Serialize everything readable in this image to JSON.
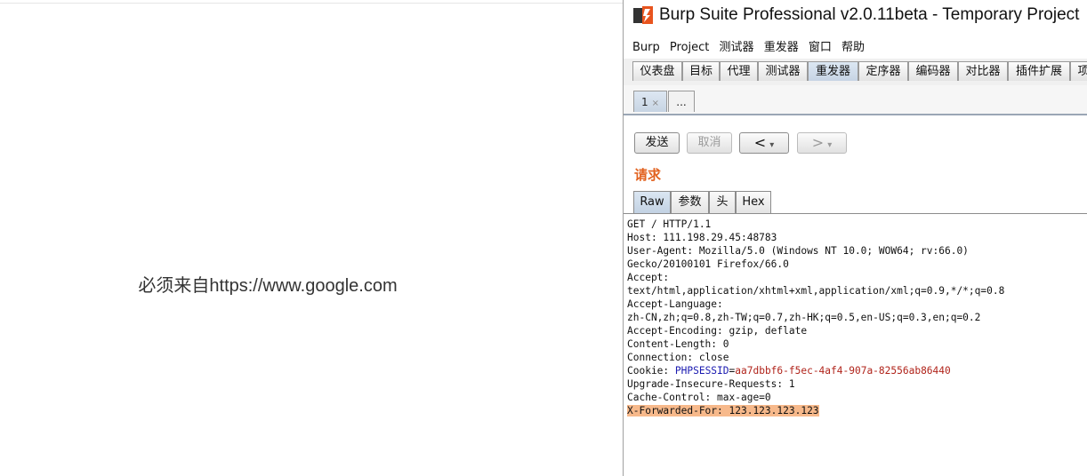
{
  "browser": {
    "message": "必须来自https://www.google.com"
  },
  "burp": {
    "title": "Burp Suite Professional v2.0.11beta - Temporary Project",
    "menu": [
      "Burp",
      "Project",
      "测试器",
      "重发器",
      "窗口",
      "帮助"
    ],
    "tabs": [
      "仪表盘",
      "目标",
      "代理",
      "测试器",
      "重发器",
      "定序器",
      "编码器",
      "对比器",
      "插件扩展",
      "项"
    ],
    "active_tab": "重发器",
    "subtabs": {
      "first": "1",
      "close": "×",
      "more": "..."
    },
    "buttons": {
      "send": "发送",
      "cancel": "取消",
      "back": "<",
      "forward": ">",
      "dropdown": "▾"
    },
    "request_label": "请求",
    "request_tabs": [
      "Raw",
      "参数",
      "头",
      "Hex"
    ],
    "request_lines": {
      "l1": "GET / HTTP/1.1",
      "l2": "Host: 111.198.29.45:48783",
      "l3": "User-Agent: Mozilla/5.0 (Windows NT 10.0; WOW64; rv:66.0)",
      "l4": "Gecko/20100101 Firefox/66.0",
      "l5": "Accept:",
      "l6": "text/html,application/xhtml+xml,application/xml;q=0.9,*/*;q=0.8",
      "l7": "Accept-Language:",
      "l8": "zh-CN,zh;q=0.8,zh-TW;q=0.7,zh-HK;q=0.5,en-US;q=0.3,en;q=0.2",
      "l9": "Accept-Encoding: gzip, deflate",
      "l10": "Content-Length: 0",
      "l11": "Connection: close",
      "cookie_prefix": "Cookie: ",
      "cookie_name": "PHPSESSID",
      "cookie_eq": "=",
      "cookie_value": "aa7dbbf6-f5ec-4af4-907a-82556ab86440",
      "l13": "Upgrade-Insecure-Requests: 1",
      "l14": "Cache-Control: max-age=0",
      "l15": "X-Forwarded-For: 123.123.123.123"
    },
    "colors": {
      "accent": "#e2621f",
      "highlight": "#f7b98b",
      "cookie_name": "#1a1ab0",
      "cookie_value": "#b0231a"
    }
  }
}
